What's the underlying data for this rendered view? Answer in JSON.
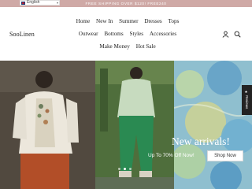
{
  "topbar": {
    "promo_text": "FREE SHIPPING OVER $120! FREE240",
    "language": "English",
    "bg_color": "#cfa9a6"
  },
  "header": {
    "logo": "SooLinen",
    "nav": {
      "row1": [
        "Home",
        "New In",
        "Summer",
        "Dresses",
        "Tops"
      ],
      "row2": [
        "Outwear",
        "Bottoms",
        "Styles",
        "Accessories"
      ],
      "row3": [
        "Make Money",
        "Hot Sale"
      ]
    },
    "icons": [
      "user-icon",
      "search-icon"
    ]
  },
  "hero": {
    "title": "New arrivals!",
    "subtitle": "Up To 70% Off Now!",
    "cta": "Shop Now",
    "slide_count": 3,
    "active_slide": 1
  },
  "reviews_tab": "★ Reviews"
}
